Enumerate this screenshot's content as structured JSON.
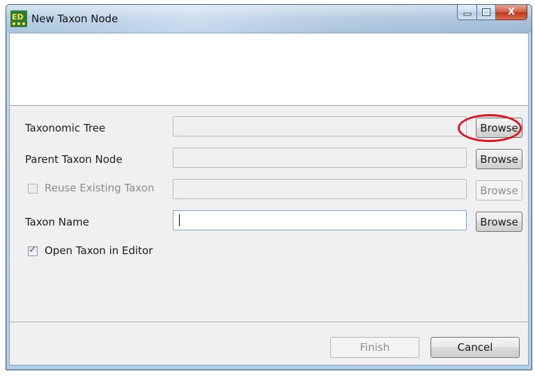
{
  "window": {
    "title": "New Taxon Node",
    "icon": "taxeditor-app-icon"
  },
  "caption_buttons": {
    "minimize_icon": "minimize-icon",
    "maximize_icon": "maximize-icon",
    "close_label": "X"
  },
  "form": {
    "taxonomic_tree": {
      "label": "Taxonomic Tree",
      "value": "",
      "button": "Browse"
    },
    "parent_taxon_node": {
      "label": "Parent Taxon Node",
      "value": "",
      "button": "Browse"
    },
    "reuse_existing_taxon": {
      "label": "Reuse Existing Taxon",
      "checked": false,
      "value": "",
      "button": "Browse"
    },
    "taxon_name": {
      "label": "Taxon Name",
      "value": "",
      "button": "Browse"
    },
    "open_in_editor": {
      "label": "Open Taxon in Editor",
      "checked": true
    }
  },
  "footer": {
    "finish": "Finish",
    "cancel": "Cancel"
  },
  "colors": {
    "highlight_annotation": "#e0121b",
    "titlebar": "#b4cde6",
    "client_bg": "#f0f0f0"
  }
}
